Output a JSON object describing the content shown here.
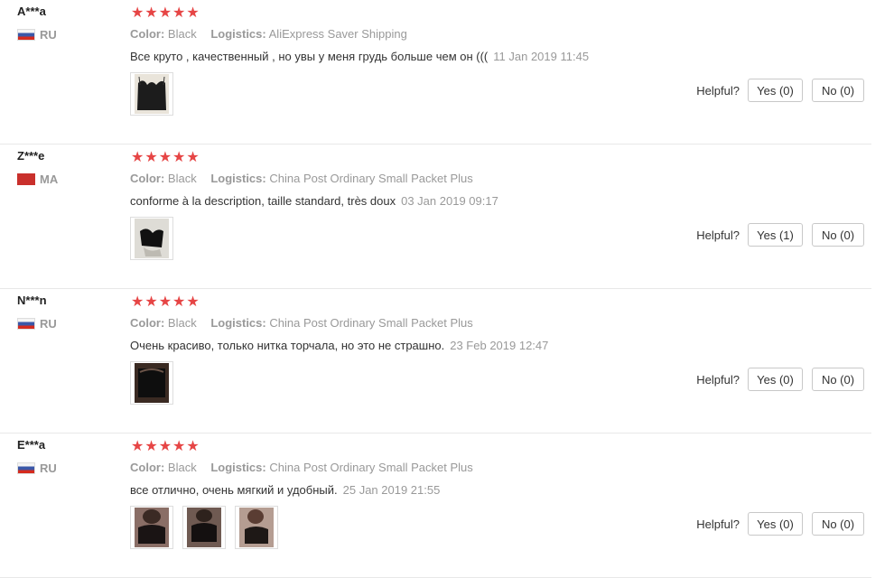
{
  "labels": {
    "color": "Color:",
    "logistics": "Logistics:",
    "helpful": "Helpful?",
    "stars": "★★★★★"
  },
  "reviews": [
    {
      "user": "A***a",
      "country": "RU",
      "color": "Black",
      "logistics": "AliExpress Saver Shipping",
      "text": "Все круто , качественный , но увы у меня грудь больше чем он (((",
      "date": "11 Jan 2019 11:45",
      "yes": "Yes (0)",
      "no": "No (0)"
    },
    {
      "user": "Z***e",
      "country": "MA",
      "color": "Black",
      "logistics": "China Post Ordinary Small Packet Plus",
      "text": "conforme à la description, taille standard, très doux",
      "date": "03 Jan 2019 09:17",
      "yes": "Yes (1)",
      "no": "No (0)"
    },
    {
      "user": "N***n",
      "country": "RU",
      "color": "Black",
      "logistics": "China Post Ordinary Small Packet Plus",
      "text": "Очень красиво, только нитка торчала, но это не страшно.",
      "date": "23 Feb 2019 12:47",
      "yes": "Yes (0)",
      "no": "No (0)"
    },
    {
      "user": "E***a",
      "country": "RU",
      "color": "Black",
      "logistics": "China Post Ordinary Small Packet Plus",
      "text": "все отлично, очень мягкий и удобный.",
      "date": "25 Jan 2019 21:55",
      "yes": "Yes (0)",
      "no": "No (0)"
    }
  ]
}
